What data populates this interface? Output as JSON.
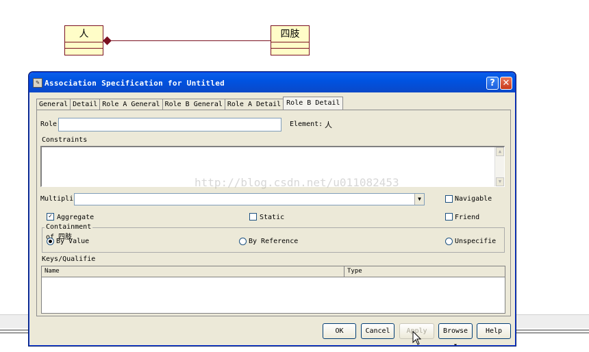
{
  "diagram": {
    "class_left": "人",
    "class_right": "四肢"
  },
  "dialog": {
    "title": "Association Specification for Untitled",
    "help_glyph": "?",
    "close_glyph": "✕"
  },
  "tabs": [
    {
      "label": "General",
      "active": false
    },
    {
      "label": "Detail",
      "active": false
    },
    {
      "label": "Role A General",
      "active": false
    },
    {
      "label": "Role B General",
      "active": false
    },
    {
      "label": "Role A Detail",
      "active": false
    },
    {
      "label": "Role B Detail",
      "active": true
    }
  ],
  "form": {
    "role_label": "Role:",
    "role_value": "",
    "element_label": "Element:",
    "element_value": "人",
    "constraints_label": "Constraints",
    "constraints_value": "",
    "multiplicity_label": "Multiplic",
    "multiplicity_value": "",
    "navigable_label": "Navigable",
    "navigable_checked": false,
    "aggregate_label": "Aggregate",
    "aggregate_checked": true,
    "static_label": "Static",
    "static_checked": false,
    "friend_label": "Friend",
    "friend_checked": false,
    "containment_title": "Containment of 四肢",
    "by_value_label": "By Value",
    "by_reference_label": "By Reference",
    "unspecified_label": "Unspecifie",
    "containment_selected": "By Value",
    "keys_label": "Keys/Qualifie",
    "keys_columns": [
      "Name",
      "Type"
    ]
  },
  "buttons": {
    "ok": "OK",
    "cancel": "Cancel",
    "apply": "Apply",
    "browse": "Browse ▾",
    "help": "Help"
  },
  "watermark": "http://blog.csdn.net/u011082453"
}
